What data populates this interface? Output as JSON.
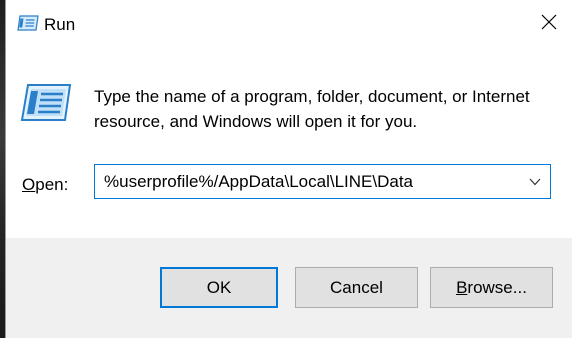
{
  "window": {
    "title": "Run",
    "title_icon": "run-icon",
    "close_icon": "close-icon"
  },
  "content": {
    "icon": "run-dialog-icon",
    "description": "Type the name of a program, folder, document, or Internet resource, and Windows will open it for you.",
    "open_label_accel": "O",
    "open_label_rest": "pen:",
    "combo_value": "%userprofile%/AppData\\Local\\LINE\\Data",
    "combo_arrow_icon": "chevron-down-icon"
  },
  "buttons": {
    "ok_label": "OK",
    "cancel_label": "Cancel",
    "browse_accel": "B",
    "browse_rest": "rowse..."
  },
  "colors": {
    "accent": "#0078d7",
    "footer_bg": "#f0f0f0",
    "button_bg": "#e1e1e1"
  }
}
